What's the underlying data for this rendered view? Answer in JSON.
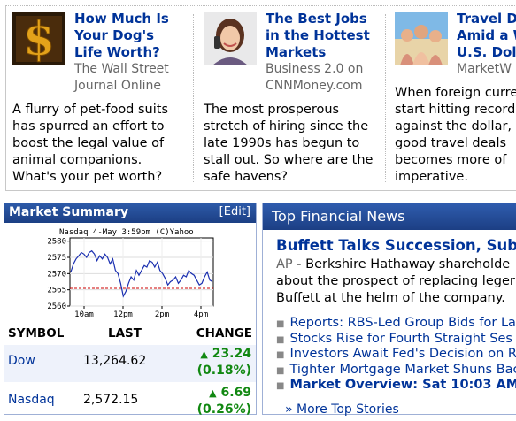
{
  "stories": [
    {
      "headline": "How Much Is Your Dog's Life Worth?",
      "headline_lines": [
        "How Much Is",
        "Your Dog's",
        "Life Worth?"
      ],
      "source_lines": [
        "The Wall Street",
        "Journal Online"
      ],
      "blurb_lines": [
        "A flurry of pet-food suits",
        "has spurred an effort to",
        "boost the legal value of",
        "animal companions.",
        "What's your pet worth?"
      ],
      "thumb_icon": "dollar-sign-icon"
    },
    {
      "headline": "The Best Jobs in the Hottest Markets",
      "headline_lines": [
        "The Best Jobs",
        "in the Hottest",
        "Markets"
      ],
      "source_lines": [
        "Business 2.0 on",
        "CNNMoney.com"
      ],
      "blurb_lines": [
        "The most prosperous",
        "stretch of hiring since the",
        "late 1990s has begun to",
        "stall out. So where are the",
        "safe havens?"
      ],
      "thumb_icon": "woman-on-phone-icon"
    },
    {
      "headline": "Travel D... Amid a W... U.S. Doll...",
      "headline_lines": [
        "Travel D",
        "Amid a W",
        "U.S. Doll"
      ],
      "source_lines": [
        "MarketW"
      ],
      "blurb_lines": [
        "When foreign curre",
        "start hitting record",
        "against the dollar, t",
        "good travel deals",
        "becomes more of",
        "imperative."
      ],
      "thumb_icon": "beach-family-icon"
    }
  ],
  "market_summary": {
    "title": "Market Summary",
    "edit_label": "[Edit]",
    "chart_caption": "Nasdaq 4-May 3:59pm (C)Yahoo!",
    "columns": [
      "SYMBOL",
      "LAST",
      "CHANGE"
    ],
    "rows": [
      {
        "symbol": "Dow",
        "last": "13,264.62",
        "change": "23.24",
        "pct": "(0.18%)"
      },
      {
        "symbol": "Nasdaq",
        "last": "2,572.15",
        "change": "6.69",
        "pct": "(0.26%)"
      }
    ]
  },
  "chart_data": {
    "type": "line",
    "title": "Nasdaq 4-May 3:59pm (C)Yahoo!",
    "x_ticks": [
      "10am",
      "12pm",
      "2pm",
      "4pm"
    ],
    "y_ticks": [
      2560,
      2565,
      2570,
      2575,
      2580
    ],
    "ylim": [
      2560,
      2581
    ],
    "reference_line": 2565.46,
    "series": [
      {
        "values": [
          2570.5,
          2573,
          2574.5,
          2575.5,
          2576.5,
          2576,
          2575,
          2576.5,
          2577,
          2576,
          2574,
          2575.5,
          2574.5,
          2576,
          2575,
          2573,
          2574.5,
          2571,
          2570,
          2567,
          2563,
          2564.5,
          2567,
          2569,
          2568,
          2571,
          2569.5,
          2571,
          2572.5,
          2572,
          2574,
          2573.5,
          2572,
          2573.5,
          2571,
          2570,
          2568.5,
          2566.5,
          2567.5,
          2568,
          2569,
          2567,
          2568,
          2569.5,
          2569,
          2571,
          2570,
          2569.5,
          2568,
          2566.5,
          2567,
          2569,
          2570.5,
          2568,
          2567.5
        ]
      }
    ]
  },
  "news": {
    "title": "Top Financial News",
    "lead_headline": "Buffett Talks Succession, Subpr",
    "lead_source": "AP",
    "lead_lines": [
      "Berkshire Hathaway shareholde",
      "about the prospect of replacing leger",
      "Buffett at the helm of the company."
    ],
    "links": [
      {
        "text": "Reports: RBS-Led Group Bids for La",
        "bold": false
      },
      {
        "text": "Stocks Rise for Fourth Straight Ses",
        "bold": false
      },
      {
        "text": "Investors Await Fed's Decision on R",
        "bold": false
      },
      {
        "text": "Tighter Mortgage Market Shuns Bac",
        "bold": false
      },
      {
        "text": "Market Overview: Sat 10:03 AM",
        "bold": true
      }
    ],
    "more_label": "More Top Stories"
  },
  "colors": {
    "link": "#003399",
    "header_bg": "#1c3f84",
    "gain": "#118811",
    "source_gray": "#666666"
  }
}
